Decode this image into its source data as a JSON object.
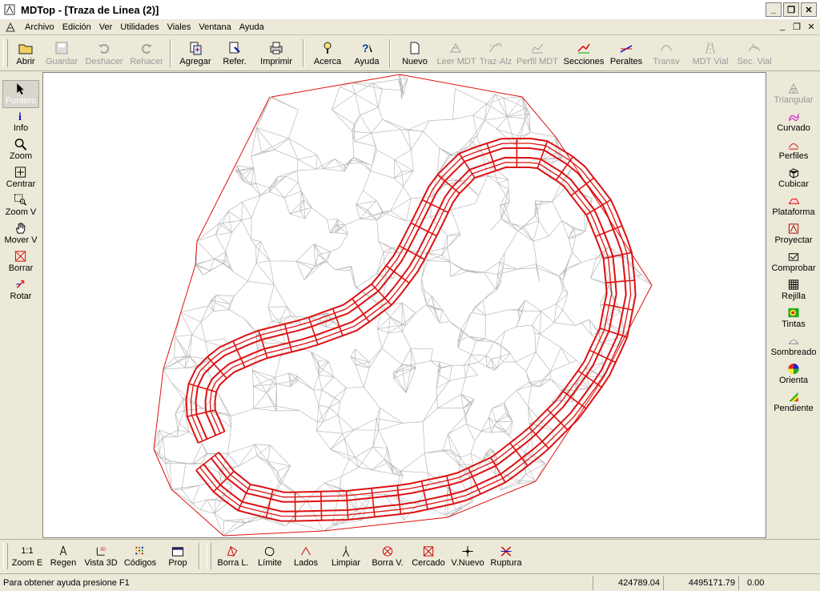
{
  "window": {
    "title": "MDTop - [Traza de Linea (2)]"
  },
  "menu": [
    "Archivo",
    "Edición",
    "Ver",
    "Utilidades",
    "Viales",
    "Ventana",
    "Ayuda"
  ],
  "toolbar": [
    {
      "label": "Abrir",
      "icon": "open-folder-icon",
      "enabled": true
    },
    {
      "label": "Guardar",
      "icon": "save-icon",
      "enabled": false
    },
    {
      "label": "Deshacer",
      "icon": "undo-icon",
      "enabled": false
    },
    {
      "label": "Rehacer",
      "icon": "redo-icon",
      "enabled": false
    },
    {
      "label": "Agregar",
      "icon": "add-file-icon",
      "enabled": true
    },
    {
      "label": "Refer.",
      "icon": "reference-icon",
      "enabled": true
    },
    {
      "label": "Imprimir",
      "icon": "printer-icon",
      "enabled": true
    },
    {
      "label": "Acerca",
      "icon": "about-icon",
      "enabled": true
    },
    {
      "label": "Ayuda",
      "icon": "help-icon",
      "enabled": true
    },
    {
      "label": "Nuevo",
      "icon": "new-icon",
      "enabled": true
    },
    {
      "label": "Leer MDT",
      "icon": "read-mdt-icon",
      "enabled": false
    },
    {
      "label": "Traz-Alz",
      "icon": "alignment-icon",
      "enabled": false
    },
    {
      "label": "Perfil MDT",
      "icon": "profile-mdt-icon",
      "enabled": false
    },
    {
      "label": "Secciones",
      "icon": "sections-icon",
      "enabled": true
    },
    {
      "label": "Peraltes",
      "icon": "superelevation-icon",
      "enabled": true
    },
    {
      "label": "Transv",
      "icon": "transverse-icon",
      "enabled": false
    },
    {
      "label": "MDT Vial",
      "icon": "road-mdt-icon",
      "enabled": false
    },
    {
      "label": "Sec. Vial",
      "icon": "road-section-icon",
      "enabled": false
    }
  ],
  "left_tools": [
    {
      "label": "Puntero",
      "icon": "pointer-icon",
      "active": true
    },
    {
      "label": "Info",
      "icon": "info-icon"
    },
    {
      "label": "Zoom",
      "icon": "magnifier-icon"
    },
    {
      "label": "Centrar",
      "icon": "center-icon"
    },
    {
      "label": "Zoom V",
      "icon": "zoom-window-icon"
    },
    {
      "label": "Mover V",
      "icon": "hand-icon"
    },
    {
      "label": "Borrar",
      "icon": "erase-icon"
    },
    {
      "label": "Rotar",
      "icon": "rotate-icon"
    }
  ],
  "right_tools": [
    {
      "label": "Triangular",
      "icon": "triangulate-icon",
      "enabled": false
    },
    {
      "label": "Curvado",
      "icon": "contour-icon",
      "enabled": true
    },
    {
      "label": "Perfiles",
      "icon": "profiles-icon",
      "enabled": true
    },
    {
      "label": "Cubicar",
      "icon": "volume-icon",
      "enabled": true
    },
    {
      "label": "Plataforma",
      "icon": "platform-icon",
      "enabled": true
    },
    {
      "label": "Proyectar",
      "icon": "project-icon",
      "enabled": true
    },
    {
      "label": "Comprobar",
      "icon": "check-icon",
      "enabled": true
    },
    {
      "label": "Rejilla",
      "icon": "grid-icon",
      "enabled": true
    },
    {
      "label": "Tintas",
      "icon": "tints-icon",
      "enabled": true
    },
    {
      "label": "Sombreado",
      "icon": "shading-icon",
      "enabled": true
    },
    {
      "label": "Orienta",
      "icon": "orientation-icon",
      "enabled": true
    },
    {
      "label": "Pendiente",
      "icon": "slope-icon",
      "enabled": true
    }
  ],
  "bottom_tools": [
    {
      "label": "Zoom E",
      "icon": "zoom-extents-icon",
      "glyph": "1:1"
    },
    {
      "label": "Regen",
      "icon": "regen-icon"
    },
    {
      "label": "Vista 3D",
      "icon": "view-3d-icon"
    },
    {
      "label": "Códigos",
      "icon": "codes-icon"
    },
    {
      "label": "Prop",
      "icon": "properties-icon"
    },
    {
      "label": "Borra L.",
      "icon": "erase-lines-icon"
    },
    {
      "label": "Límite",
      "icon": "boundary-icon"
    },
    {
      "label": "Lados",
      "icon": "sides-icon"
    },
    {
      "label": "Limpiar",
      "icon": "clean-icon"
    },
    {
      "label": "Borra V.",
      "icon": "erase-vertex-icon"
    },
    {
      "label": "Cercado",
      "icon": "fence-icon"
    },
    {
      "label": "V.Nuevo",
      "icon": "new-vertex-icon"
    },
    {
      "label": "Ruptura",
      "icon": "breakline-icon"
    }
  ],
  "status": {
    "help": "Para obtener ayuda presione F1",
    "x": "424789.04",
    "y": "4495171.79",
    "z": "0.00"
  },
  "colors": {
    "road": "#dd1111",
    "mesh": "#b9b9b9",
    "canvas_bg": "#ffffff"
  }
}
